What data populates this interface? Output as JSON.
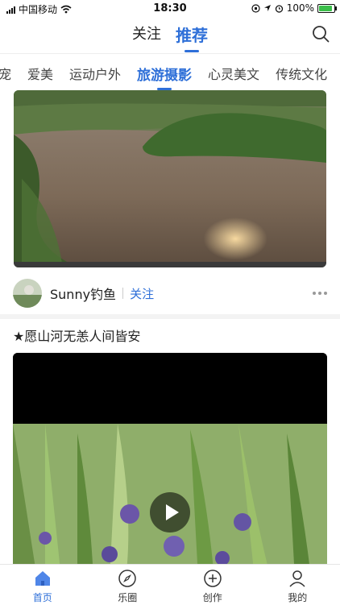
{
  "status_bar": {
    "carrier": "中国移动",
    "time": "18:30",
    "battery_percent": "100%",
    "battery_level": 1.0
  },
  "top_nav": {
    "tabs": [
      {
        "label": "关注",
        "active": false
      },
      {
        "label": "推荐",
        "active": true
      }
    ],
    "search_icon": "search-icon"
  },
  "categories": [
    {
      "label": "萌宠",
      "active": false
    },
    {
      "label": "爱美",
      "active": false
    },
    {
      "label": "运动户外",
      "active": false
    },
    {
      "label": "旅游摄影",
      "active": true
    },
    {
      "label": "心灵美文",
      "active": false
    },
    {
      "label": "传统文化",
      "active": false
    }
  ],
  "feed": {
    "post1": {
      "author": "Sunny钓鱼",
      "follow_label": "关注"
    },
    "post2": {
      "title": "★愿山河无恙人间皆安"
    }
  },
  "tab_bar": {
    "items": [
      {
        "label": "首页",
        "icon": "home-icon",
        "active": true
      },
      {
        "label": "乐圈",
        "icon": "compass-icon",
        "active": false
      },
      {
        "label": "创作",
        "icon": "plus-circle-icon",
        "active": false
      },
      {
        "label": "我的",
        "icon": "profile-icon",
        "active": false
      }
    ]
  },
  "colors": {
    "accent": "#2e6fd8",
    "battery": "#3bbf4a"
  }
}
